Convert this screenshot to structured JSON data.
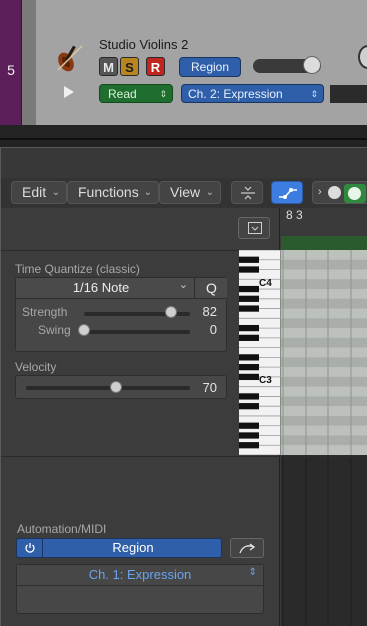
{
  "track": {
    "number": "5",
    "name": "Studio Violins 2",
    "mute_label": "M",
    "solo_label": "S",
    "record_label": "R",
    "region_label": "Region",
    "read_label": "Read",
    "automation_param": "Ch. 2: Expression"
  },
  "toolbar": {
    "edit_label": "Edit",
    "functions_label": "Functions",
    "view_label": "View"
  },
  "ruler": {
    "position": "8 3"
  },
  "inspector": {
    "time_quantize_label": "Time Quantize (classic)",
    "quantize_value": "1/16 Note",
    "q_button": "Q",
    "strength_label": "Strength",
    "strength_value": "82",
    "strength_level": 0.82,
    "swing_label": "Swing",
    "swing_value": "0",
    "swing_level": 0.0,
    "velocity_label": "Velocity",
    "velocity_value": "70",
    "velocity_level": 0.55,
    "automation_midi_label": "Automation/MIDI",
    "automation_region_label": "Region",
    "automation_param": "Ch. 1: Expression"
  },
  "piano": {
    "c4": "C4",
    "c3": "C3"
  },
  "colors": {
    "track_strip": "#5c1e58",
    "solo": "#b8861e",
    "record": "#c0261f",
    "region_blue": "#2f5fa8",
    "read_green": "#1f6e2f",
    "accent_blue": "#3d7de0",
    "midi_green": "#2f8a3d"
  }
}
